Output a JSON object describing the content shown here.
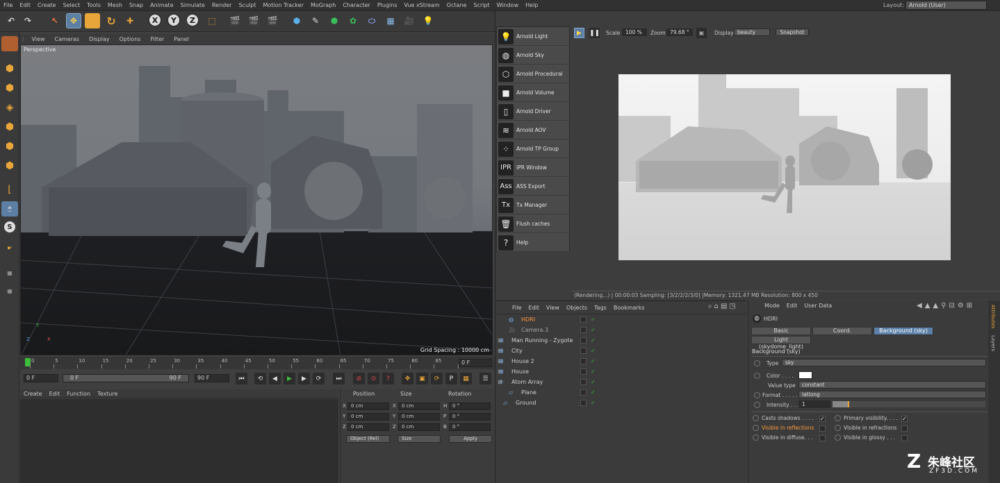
{
  "menubar": {
    "items": [
      "File",
      "Edit",
      "Create",
      "Select",
      "Tools",
      "Mesh",
      "Snap",
      "Animate",
      "Simulate",
      "Render",
      "Sculpt",
      "Motion Tracker",
      "MoGraph",
      "Character",
      "Plugins",
      "Vue xStream",
      "Octane",
      "Script",
      "Window",
      "Help"
    ],
    "layout_label": "Layout:",
    "layout_value": "Arnold (User)"
  },
  "toolbar": {
    "x_label": "X",
    "y_label": "Y",
    "z_label": "Z",
    "left_tool_letter": "S"
  },
  "viewport": {
    "menu": [
      "View",
      "Cameras",
      "Display",
      "Options",
      "Filter",
      "Panel"
    ],
    "label": "Perspective",
    "grid_spacing": "Grid Spacing : 10000 cm",
    "axis_y": "Y",
    "axis_z": "Z",
    "axis_x": "X"
  },
  "timeline": {
    "ticks": [
      "0",
      "5",
      "10",
      "15",
      "20",
      "25",
      "30",
      "35",
      "40",
      "45",
      "50",
      "55",
      "60",
      "65",
      "70",
      "75",
      "80",
      "85",
      "90"
    ],
    "end_field": "0 F",
    "start_frame": "0 F",
    "range_start": "0 F",
    "range_end": "90 F",
    "end_frame": "90 F"
  },
  "material_manager": {
    "menu": [
      "Create",
      "Edit",
      "Function",
      "Texture"
    ]
  },
  "coordinates": {
    "headers": {
      "position": "Position",
      "size": "Size",
      "rotation": "Rotation"
    },
    "rows": [
      {
        "axis": "X",
        "pos": "0 cm",
        "saxis": "X",
        "size": "0 cm",
        "raxis": "H",
        "rot": "0 °"
      },
      {
        "axis": "Y",
        "pos": "0 cm",
        "saxis": "Y",
        "size": "0 cm",
        "raxis": "P",
        "rot": "0 °"
      },
      {
        "axis": "Z",
        "pos": "0 cm",
        "saxis": "Z",
        "size": "0 cm",
        "raxis": "B",
        "rot": "0 °"
      }
    ],
    "mode_dropdown": "Object (Rel)",
    "size_dropdown": "Size",
    "apply_label": "Apply"
  },
  "arnold_menu": {
    "items": [
      {
        "label": "Arnold Light",
        "icon": "lightbulb-icon",
        "glyph": "💡"
      },
      {
        "label": "Arnold Sky",
        "icon": "sky-sphere-icon",
        "glyph": "◍"
      },
      {
        "label": "Arnold Procedural",
        "icon": "procedural-cube-icon",
        "glyph": "⬡"
      },
      {
        "label": "Arnold Volume",
        "icon": "volume-cube-icon",
        "glyph": "■"
      },
      {
        "label": "Arnold Driver",
        "icon": "driver-document-icon",
        "glyph": "▯"
      },
      {
        "label": "Arnold AOV",
        "icon": "aov-layers-icon",
        "glyph": "≋"
      },
      {
        "label": "Arnold TP Group",
        "icon": "tp-group-icon",
        "glyph": "⁘"
      },
      {
        "label": "IPR Window",
        "icon": "ipr-icon",
        "glyph": "IPR"
      },
      {
        "label": "ASS Export",
        "icon": "ass-export-icon",
        "glyph": "Ass"
      },
      {
        "label": "Tx Manager",
        "icon": "tx-manager-icon",
        "glyph": "Tx"
      },
      {
        "label": "Flush caches",
        "icon": "trash-icon",
        "glyph": "🗑"
      },
      {
        "label": "Help",
        "icon": "help-icon",
        "glyph": "?"
      }
    ]
  },
  "ipr": {
    "scale_label": "Scale",
    "scale_value": "100 %",
    "zoom_label": "Zoom",
    "zoom_value": "79.68 °",
    "display_label": "Display",
    "display_value": "beauty",
    "snapshot_label": "Snapshot",
    "status": "(Rendering...) | 00:00:03  Sampling: [3/2/2/2/3/0] |Memory: 1321.47 MB  Resolution: 800 x 450"
  },
  "object_manager": {
    "menu": [
      "File",
      "Edit",
      "View",
      "Objects",
      "Tags",
      "Bookmarks"
    ],
    "objects": [
      {
        "name": "HDRI",
        "selected": true,
        "color": "#ff9a3c"
      },
      {
        "name": "Camera.3",
        "selected": false,
        "color": "#a8a8a8"
      },
      {
        "name": "Man Running - Zygote",
        "selected": false,
        "color": "#d0d0d0"
      },
      {
        "name": "City",
        "selected": false,
        "color": "#d0d0d0"
      },
      {
        "name": "House 2",
        "selected": false,
        "color": "#d0d0d0"
      },
      {
        "name": "House",
        "selected": false,
        "color": "#d0d0d0"
      },
      {
        "name": "Atom Array",
        "selected": false,
        "color": "#d0d0d0"
      },
      {
        "name": "Plane",
        "selected": false,
        "color": "#d0d0d0"
      },
      {
        "name": "Ground",
        "selected": false,
        "color": "#d0d0d0"
      }
    ]
  },
  "attributes": {
    "menu": [
      "Mode",
      "Edit",
      "User Data"
    ],
    "object_name": "HDRI",
    "tabs": [
      "Basic",
      "Coord.",
      "Background (sky)"
    ],
    "active_tab": "Background (sky)",
    "subtab": "Light (skydome_light)",
    "section": "Background (sky)",
    "type_label": "Type",
    "type_value": "sky",
    "color_label": "Color . . . .",
    "value_type_label": "Value type",
    "value_type": "constant",
    "format_label": "Format . . . . .",
    "format_value": "latlong",
    "intensity_label": "Intensity . . .",
    "intensity_value": "1",
    "checks": [
      {
        "label": "Casts shadows . . . .",
        "checked": true
      },
      {
        "label": "Primary visibility. . . .",
        "checked": true
      },
      {
        "label": "Visible in reflections",
        "checked": false,
        "highlight": true
      },
      {
        "label": "Visible in refractions",
        "checked": false
      },
      {
        "label": "Visible in diffuse. . .",
        "checked": false
      },
      {
        "label": "Visible in glossy . . .",
        "checked": false
      }
    ],
    "side_tabs": [
      "Attributes",
      "Layers"
    ]
  },
  "watermark": {
    "brand": "朱峰社区",
    "url": "ZF3D.COM"
  },
  "colors": {
    "accent": "#5c80a8",
    "selected_object": "#ff9a3c",
    "play_green": "#3bbf3b"
  }
}
